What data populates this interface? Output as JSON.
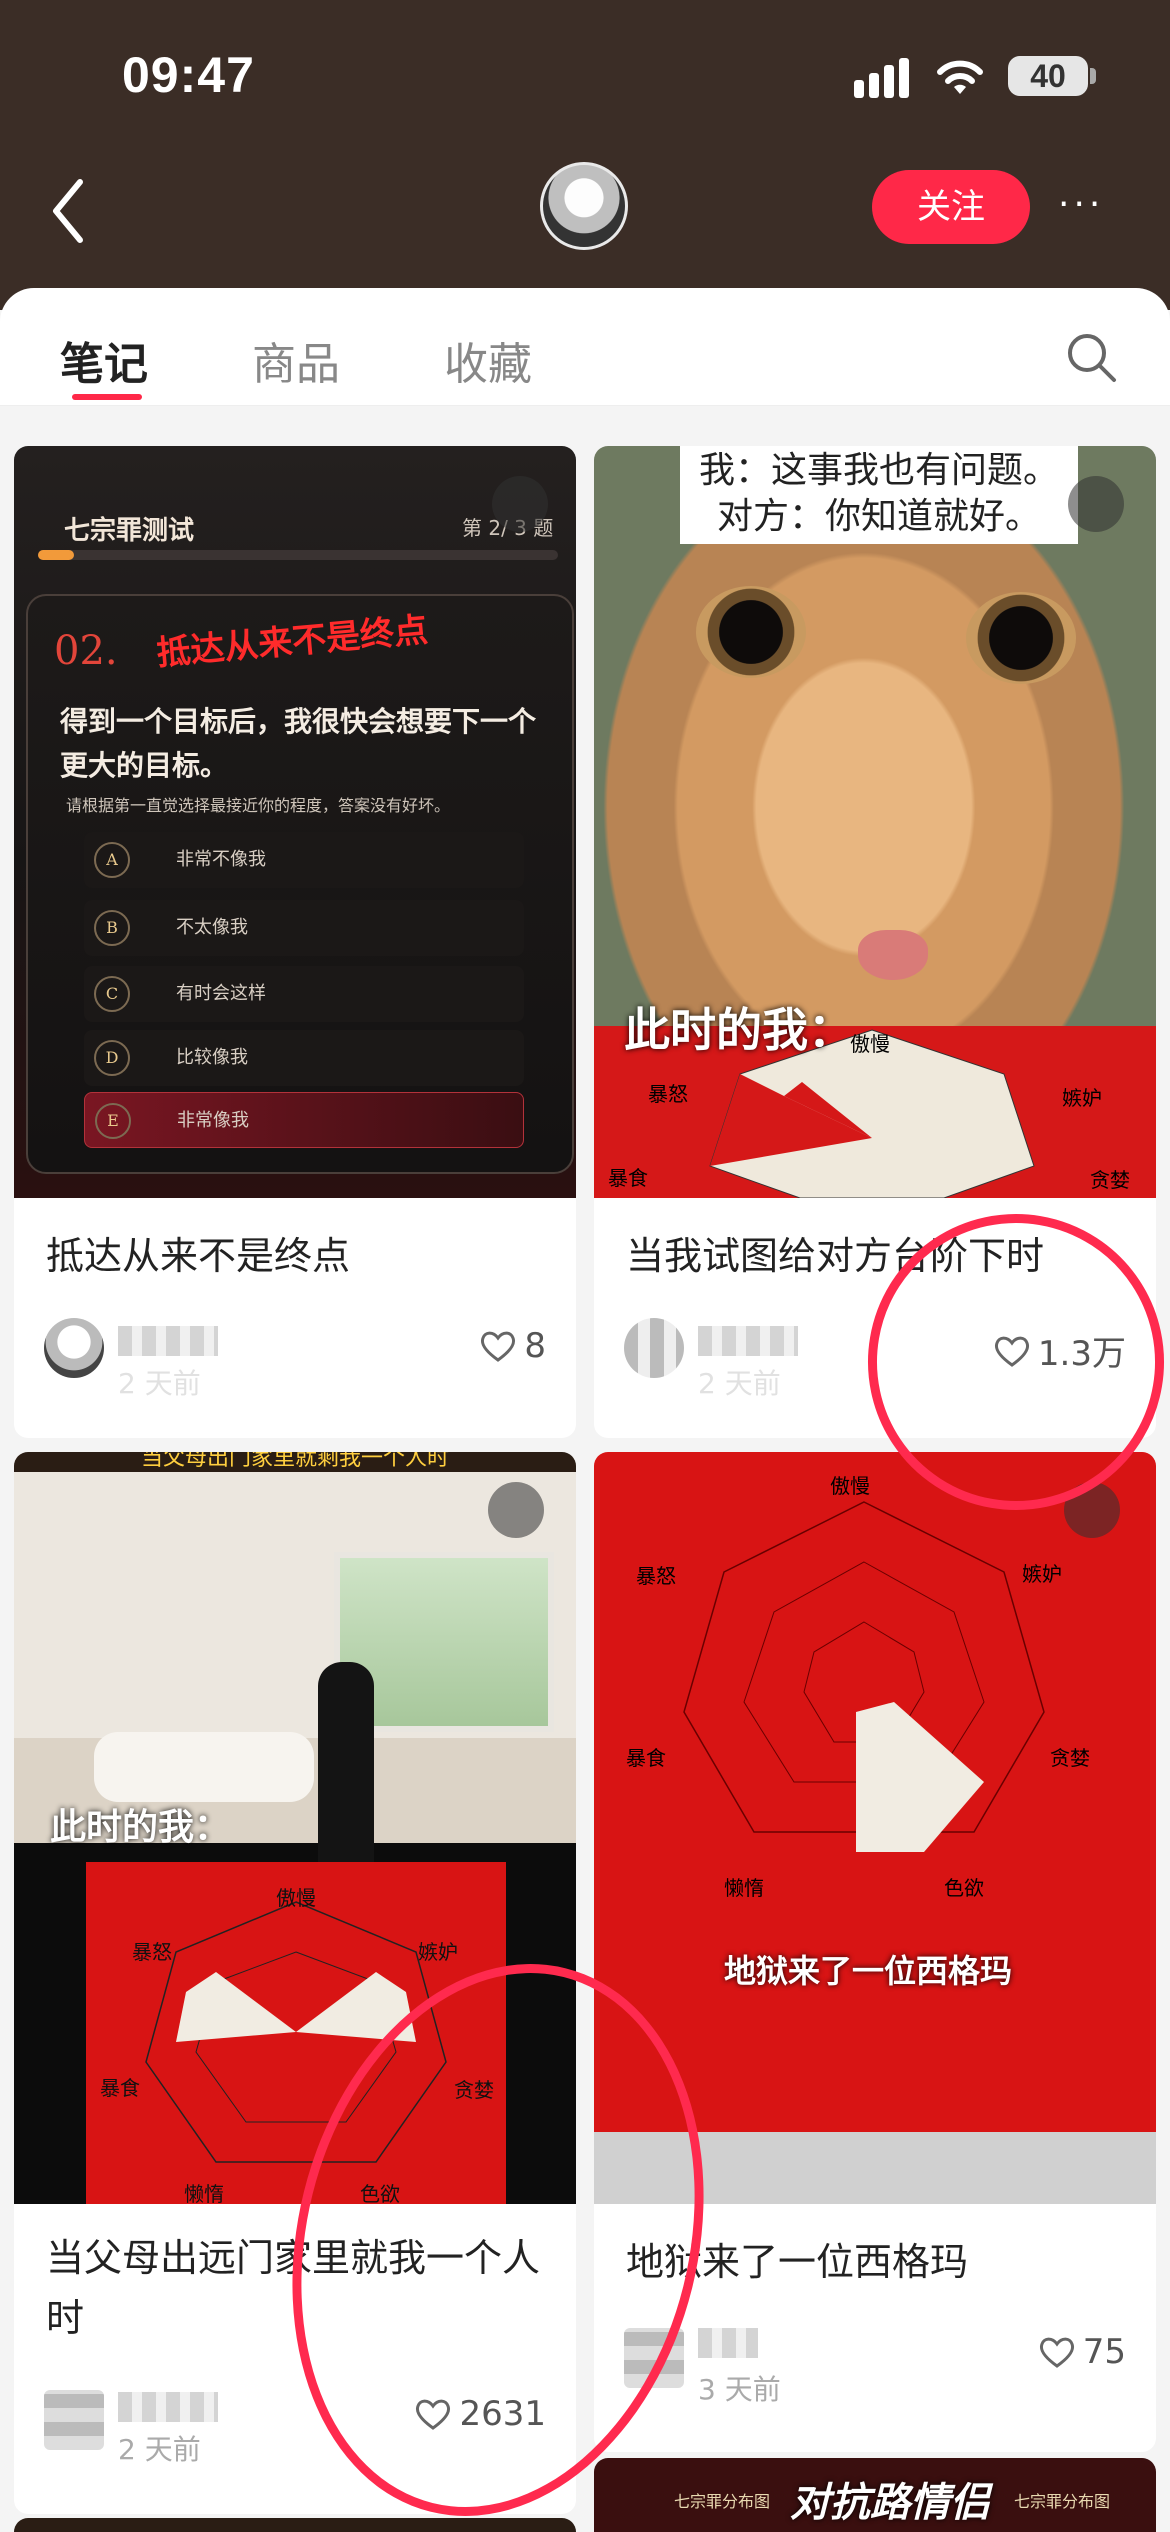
{
  "status_bar": {
    "time": "09:47",
    "battery": "40"
  },
  "header": {
    "follow_label": "关注",
    "more_label": "···"
  },
  "tabs": [
    {
      "label": "笔记"
    },
    {
      "label": "商品"
    },
    {
      "label": "收藏"
    }
  ],
  "accent_color": "#ff2848",
  "cards": [
    {
      "title": "抵达从来不是终点",
      "time": "2 天前",
      "likes": "8",
      "media": {
        "header": "七宗罪测试",
        "page": "第 2/ 3 题",
        "num": "02.",
        "headline": "抵达从来不是终点",
        "question": "得到一个目标后，我很快会想要下一个更大的目标。",
        "hint": "请根据第一直觉选择最接近你的程度，答案没有好坏。",
        "options": [
          {
            "letter": "A",
            "text": "非常不像我"
          },
          {
            "letter": "B",
            "text": "不太像我"
          },
          {
            "letter": "C",
            "text": "有时会这样"
          },
          {
            "letter": "D",
            "text": "比较像我"
          },
          {
            "letter": "E",
            "text": "非常像我"
          }
        ]
      }
    },
    {
      "title": "当我试图给对方台阶下时",
      "time": "2 天前",
      "likes": "1.3万",
      "media": {
        "caption_line1": "我：这事我也有问题。",
        "caption_line2": "对方：你知道就好。",
        "label": "此时的我：",
        "radar_labels": [
          "傲慢",
          "暴怒",
          "嫉妒",
          "暴食",
          "贪婪"
        ]
      }
    },
    {
      "title": "当父母出远门家里就我一个人时",
      "time": "2 天前",
      "likes": "2631",
      "media": {
        "banner": "当父母出门家里就剩我一个人时",
        "label": "此时的我：",
        "radar_labels": [
          "傲慢",
          "暴怒",
          "嫉妒",
          "暴食",
          "贪婪",
          "懒惰",
          "色欲"
        ]
      }
    },
    {
      "title": "地狱来了一位西格玛",
      "time": "3 天前",
      "likes": "75",
      "media": {
        "overlay": "地狱来了一位西格玛",
        "radar_labels": [
          "傲慢",
          "暴怒",
          "嫉妒",
          "暴食",
          "贪婪",
          "懒惰",
          "色欲"
        ]
      }
    },
    {
      "title": "",
      "media": {
        "overlay": "对抗路情侣",
        "small_left": "七宗罪分布图",
        "small_right": "七宗罪分布图"
      }
    }
  ]
}
